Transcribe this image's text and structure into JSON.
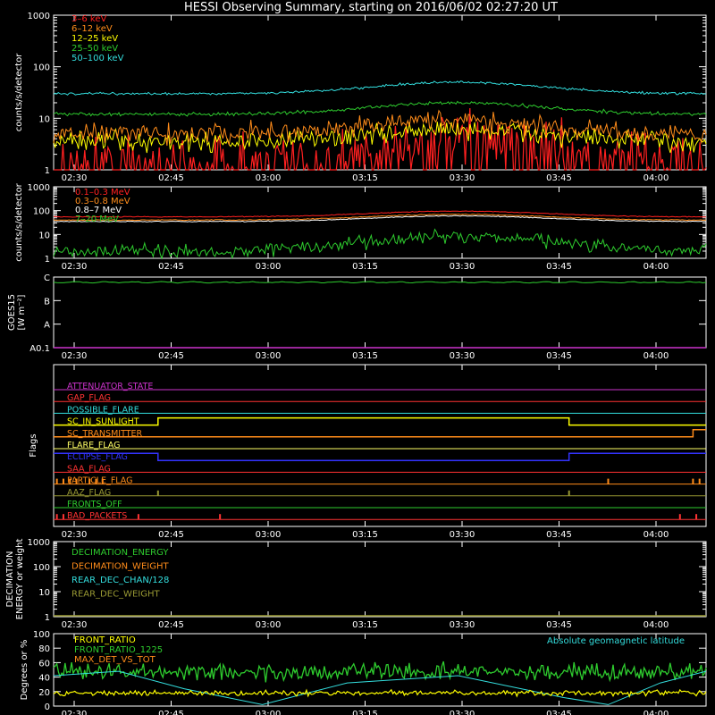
{
  "title": "HESSI Observing Summary, starting on 2016/06/02 02:27:20 UT",
  "time_ticks": [
    "02:30",
    "02:45",
    "03:00",
    "03:15",
    "03:30",
    "03:45",
    "04:00"
  ],
  "chart_data": [
    {
      "type": "line",
      "id": "low_energy",
      "ylabel": "counts/s/detector",
      "yscale": "log",
      "ylim": [
        1,
        1000
      ],
      "yticks": [
        "1",
        "10",
        "100",
        "1000"
      ],
      "series": [
        {
          "name": "3–6 keV",
          "color": "#ff2020",
          "baseline": 1.5,
          "peak": 4,
          "noise": 0.9,
          "spiky": true
        },
        {
          "name": "6–12 keV",
          "color": "#ff8c1a",
          "baseline": 5,
          "peak": 9,
          "noise": 0.35
        },
        {
          "name": "12–25 keV",
          "color": "#ffff00",
          "baseline": 3.5,
          "peak": 6,
          "noise": 0.35
        },
        {
          "name": "25–50 keV",
          "color": "#2ecc2e",
          "baseline": 12,
          "peak": 20,
          "noise": 0.06
        },
        {
          "name": "50–100 keV",
          "color": "#33dddd",
          "baseline": 30,
          "peak": 50,
          "noise": 0.04
        }
      ]
    },
    {
      "type": "line",
      "id": "high_energy",
      "ylabel": "counts/s/detector",
      "yscale": "log",
      "ylim": [
        1,
        1000
      ],
      "yticks": [
        "1",
        "10",
        "100",
        "1000"
      ],
      "series": [
        {
          "name": "0.1–0.3 MeV",
          "color": "#ff2020",
          "baseline": 55,
          "peak": 95,
          "noise": 0.03
        },
        {
          "name": "0.3–0.8 MeV",
          "color": "#ff8c1a",
          "baseline": 40,
          "peak": 70,
          "noise": 0.03
        },
        {
          "name": "0.8–7 MeV",
          "color": "#ffffff",
          "baseline": 35,
          "peak": 60,
          "noise": 0.03
        },
        {
          "name": "7–20 MeV",
          "color": "#2ecc2e",
          "baseline": 2,
          "peak": 8,
          "noise": 0.5
        }
      ]
    },
    {
      "type": "line",
      "id": "goes",
      "ylabel_lines": [
        "GOES15",
        "[W m⁻²]"
      ],
      "yticks": [
        "A0.1",
        "A",
        "B",
        "C"
      ],
      "series": [
        {
          "name": "GOES15",
          "color": "#2ecc2e",
          "level_class": "B",
          "level_fraction_of_decade": 0.78
        }
      ]
    },
    {
      "type": "line",
      "id": "flags",
      "ylabel": "Flags",
      "series": [
        {
          "name": "ATTENUATOR_STATE",
          "color": "#cc33cc",
          "steps": []
        },
        {
          "name": "GAP_FLAG",
          "color": "#ff3333",
          "steps": []
        },
        {
          "name": "POSSIBLE_FLARE",
          "color": "#33dddd",
          "steps": []
        },
        {
          "name": "SC_IN_SUNLIGHT",
          "color": "#ffff00",
          "steps": [
            [
              0.0,
              0
            ],
            [
              0.16,
              1
            ],
            [
              0.79,
              0
            ]
          ]
        },
        {
          "name": "SC_TRANSMITTER",
          "color": "#ff8c1a",
          "steps": [
            [
              0.0,
              0
            ],
            [
              0.98,
              1
            ]
          ]
        },
        {
          "name": "FLARE_FLAG",
          "color": "#ffff66",
          "steps": []
        },
        {
          "name": "ECLIPSE_FLAG",
          "color": "#3333ff",
          "steps": [
            [
              0.0,
              1
            ],
            [
              0.16,
              0
            ],
            [
              0.79,
              1
            ]
          ]
        },
        {
          "name": "SAA_FLAG",
          "color": "#ff3333",
          "steps": []
        },
        {
          "name": "PARTICLE_FLAG",
          "color": "#ff8c1a",
          "spikes": [
            0.005,
            0.015,
            0.025,
            0.035,
            0.055,
            0.065,
            0.075,
            0.85,
            0.98,
            0.99
          ]
        },
        {
          "name": "AAZ_FLAG",
          "color": "#999933",
          "spikes": [
            0.16,
            0.79
          ]
        },
        {
          "name": "FRONTS_OFF",
          "color": "#2ecc2e",
          "steps": []
        },
        {
          "name": "BAD_PACKETS",
          "color": "#ff3333",
          "spikes": [
            0.005,
            0.015,
            0.13,
            0.255,
            0.96,
            0.985
          ]
        }
      ]
    },
    {
      "type": "line",
      "id": "decimation",
      "ylabel_lines": [
        "DECIMATION",
        "ENERGY or weight"
      ],
      "yticks": [
        "1",
        "10",
        "100",
        "1000"
      ],
      "series": [
        {
          "name": "DECIMATION_ENERGY",
          "color": "#2ecc2e"
        },
        {
          "name": "DECIMATION_WEIGHT",
          "color": "#ff8c1a"
        },
        {
          "name": "REAR_DEC_CHAN/128",
          "color": "#33dddd"
        },
        {
          "name": "REAR_DEC_WEIGHT",
          "color": "#999933"
        }
      ]
    },
    {
      "type": "line",
      "id": "ratios",
      "ylabel": "Degrees or %",
      "ylim": [
        0,
        100
      ],
      "yticks": [
        "0",
        "20",
        "40",
        "60",
        "80",
        "100"
      ],
      "right_annotation": "Absolute geomagnetic latitude",
      "right_annotation_color": "#33dddd",
      "series": [
        {
          "name": "FRONT_RATIO",
          "color": "#ffff00",
          "baseline": 18,
          "noise": 3
        },
        {
          "name": "FRONT_RATIO_1225",
          "color": "#2ecc2e",
          "baseline": 47,
          "noise": 9
        },
        {
          "name": "MAX_DET_VS_TOT",
          "color": "#ff8c1a"
        }
      ]
    }
  ],
  "colors": {
    "background": "#000000",
    "axis": "#ffffff"
  }
}
